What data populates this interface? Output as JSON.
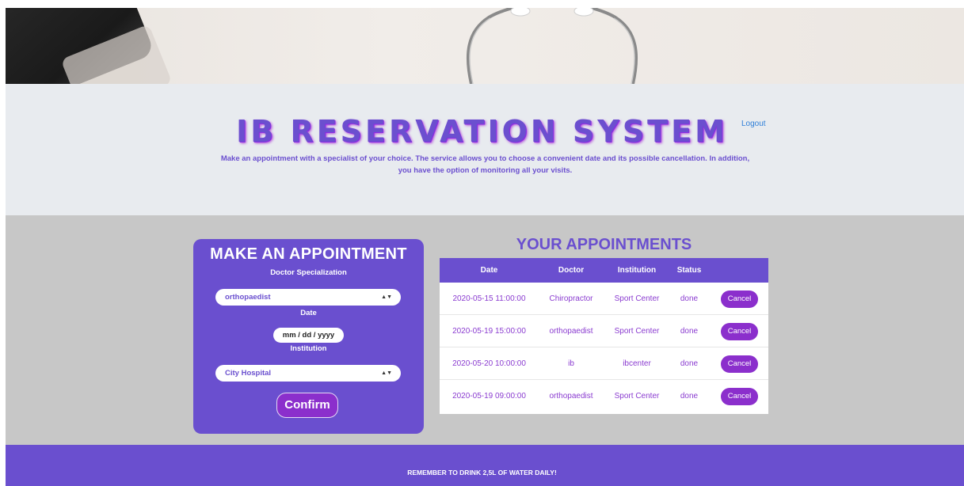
{
  "header": {
    "title": "IB RESERVATION SYSTEM",
    "subtitle_line1": "Make an appointment with a specialist of your choice. The service allows you to choose a convenient date and its possible cancellation. In addition,",
    "subtitle_line2": "you have the option of monitoring all your visits.",
    "logout_label": "Logout"
  },
  "form": {
    "title": "MAKE AN APPOINTMENT",
    "specialization_label": "Doctor Specialization",
    "specialization_value": "orthopaedist",
    "date_label": "Date",
    "date_placeholder": "mm / dd / yyyy",
    "institution_label": "Institution",
    "institution_value": "City Hospital",
    "confirm_label": "Confirm"
  },
  "appointments": {
    "title": "YOUR APPOINTMENTS",
    "columns": [
      "Date",
      "Doctor",
      "Institution",
      "Status"
    ],
    "rows": [
      {
        "date": "2020-05-15 11:00:00",
        "doctor": "Chiropractor",
        "institution": "Sport Center",
        "status": "done",
        "action": "Cancel"
      },
      {
        "date": "2020-05-19 15:00:00",
        "doctor": "orthopaedist",
        "institution": "Sport Center",
        "status": "done",
        "action": "Cancel"
      },
      {
        "date": "2020-05-20 10:00:00",
        "doctor": "ib",
        "institution": "ibcenter",
        "status": "done",
        "action": "Cancel"
      },
      {
        "date": "2020-05-19 09:00:00",
        "doctor": "orthopaedist",
        "institution": "Sport Center",
        "status": "done",
        "action": "Cancel"
      }
    ]
  },
  "footer": {
    "text": "REMEMBER TO DRINK 2,5L OF WATER DAILY!"
  },
  "colors": {
    "accent": "#6a4fcf",
    "button": "#8b2fcc",
    "link": "#2f7fd8",
    "header_bg": "#e8ebef",
    "main_bg": "#c7c7c7"
  }
}
